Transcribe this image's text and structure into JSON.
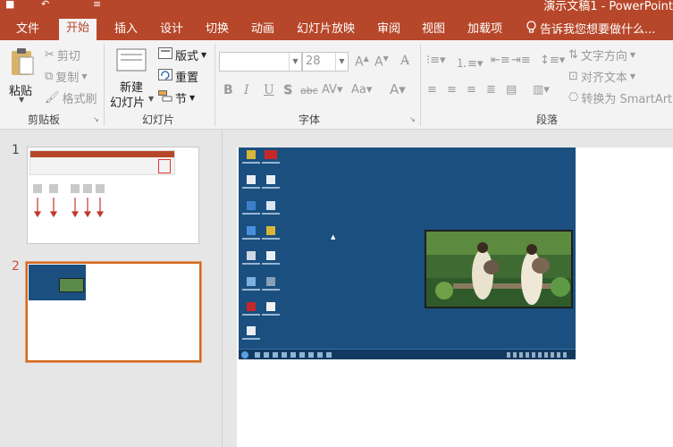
{
  "window": {
    "title": "演示文稿1 - PowerPoint",
    "quick_access": [
      "save",
      "undo",
      "redo",
      "customize"
    ]
  },
  "tabs": [
    "文件",
    "开始",
    "插入",
    "设计",
    "切换",
    "动画",
    "幻灯片放映",
    "审阅",
    "视图",
    "加载项"
  ],
  "active_tab": "开始",
  "tell_me": "告诉我您想要做什么...",
  "ribbon": {
    "clipboard": {
      "label": "剪贴板",
      "paste": "粘贴",
      "cut": "剪切",
      "copy": "复制",
      "format_painter": "格式刷"
    },
    "slides": {
      "label": "幻灯片",
      "new_slide_line1": "新建",
      "new_slide_line2": "幻灯片",
      "layout": "版式",
      "reset": "重置",
      "section": "节"
    },
    "font": {
      "label": "字体",
      "font_name": "",
      "font_size": "28"
    },
    "paragraph": {
      "label": "段落",
      "text_direction": "文字方向",
      "align_text": "对齐文本",
      "convert_smartart": "转换为 SmartArt"
    }
  },
  "slides_panel": [
    {
      "number": "1",
      "selected": false
    },
    {
      "number": "2",
      "selected": true
    }
  ],
  "colors": {
    "accent": "#b7472a",
    "selection": "#d2691e",
    "desktop": "#1a4f80"
  }
}
